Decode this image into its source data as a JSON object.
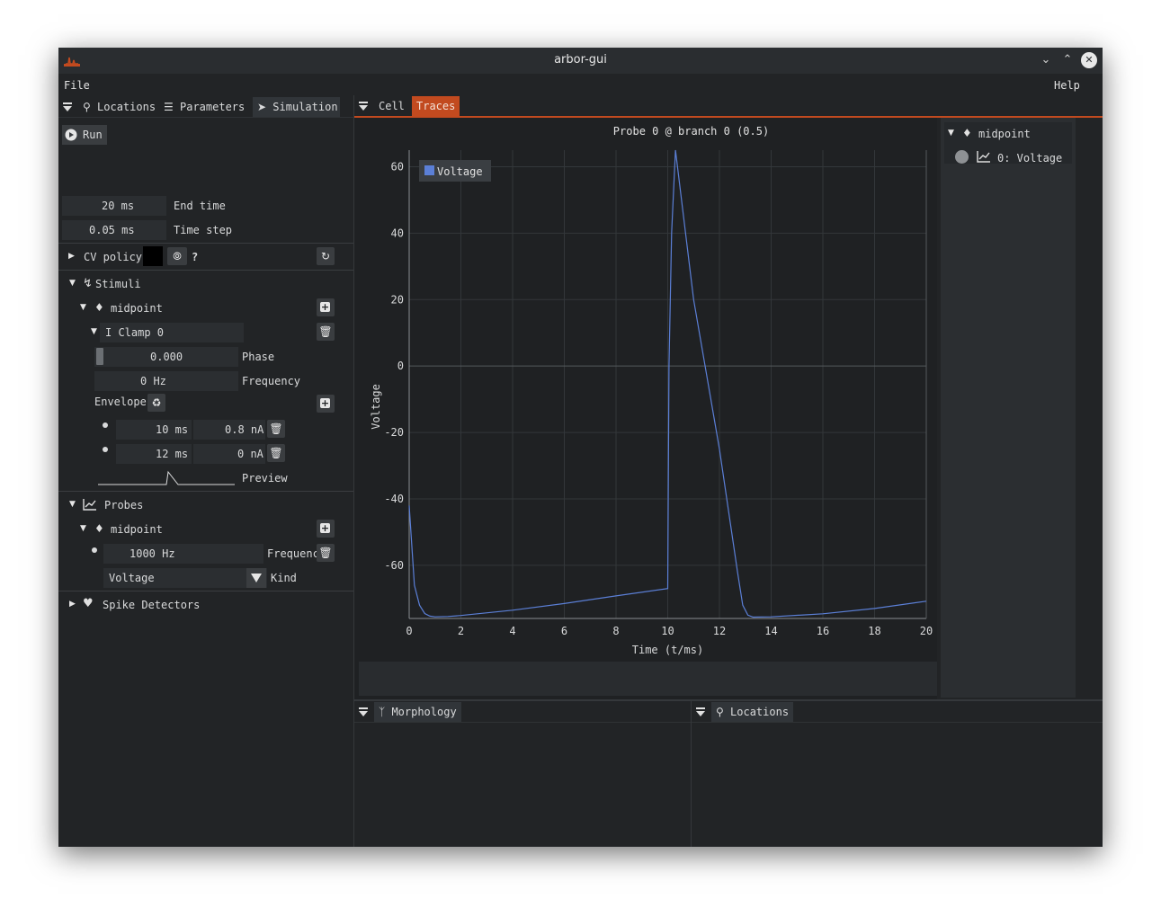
{
  "window": {
    "title": "arbor-gui"
  },
  "menu": {
    "file": "File",
    "help": "Help"
  },
  "left_tabs": {
    "locations": "Locations",
    "parameters": "Parameters",
    "simulation": "Simulation"
  },
  "simulation": {
    "run_label": "Run",
    "end_time_value": "20 ms",
    "end_time_label": "End time",
    "time_step_value": "0.05 ms",
    "time_step_label": "Time step",
    "cv_policy_label": "CV policy",
    "cv_help": "?",
    "stimuli_label": "Stimuli",
    "stim_location": "midpoint",
    "clamp_label": "I Clamp 0",
    "phase_value": "0.000",
    "phase_label": "Phase",
    "frequency_value": "0 Hz",
    "frequency_label": "Frequency",
    "envelope_label": "Envelope",
    "envelope": [
      {
        "time": "10 ms",
        "amplitude": "0.8 nA"
      },
      {
        "time": "12 ms",
        "amplitude": "0 nA"
      }
    ],
    "preview_label": "Preview",
    "probes_label": "Probes",
    "probe_location": "midpoint",
    "probe_freq_value": "1000 Hz",
    "probe_freq_label": "Frequenc",
    "probe_kind_value": "Voltage",
    "probe_kind_label": "Kind",
    "spike_label": "Spike Detectors"
  },
  "right_tabs": {
    "cell": "Cell",
    "traces": "Traces"
  },
  "trace_panel": {
    "location": "midpoint",
    "item": "0: Voltage"
  },
  "bottom_tabs": {
    "morphology": "Morphology",
    "locations": "Locations"
  },
  "colors": {
    "accent": "#c24a1f",
    "trace": "#5b7fd6",
    "background": "#222426"
  },
  "chart_data": {
    "type": "line",
    "title": "Probe 0 @ branch 0 (0.5)",
    "xlabel": "Time (t/ms)",
    "ylabel": "Voltage",
    "xlim": [
      0,
      20
    ],
    "ylim": [
      -76,
      65
    ],
    "xticks": [
      0,
      2,
      4,
      6,
      8,
      10,
      12,
      14,
      16,
      18,
      20
    ],
    "yticks": [
      60,
      40,
      20,
      0,
      -20,
      -40,
      -60
    ],
    "grid": true,
    "legend_position": "top-left",
    "series": [
      {
        "name": "Voltage",
        "x": [
          0,
          0.2,
          0.4,
          0.6,
          0.8,
          1.0,
          1.5,
          2,
          4,
          6,
          8,
          10.0,
          10.05,
          10.15,
          10.3,
          11.0,
          12.0,
          12.7,
          12.9,
          13.1,
          13.3,
          14,
          16,
          18,
          20
        ],
        "y": [
          -42,
          -66,
          -72,
          -74.5,
          -75.3,
          -75.5,
          -75.4,
          -75.1,
          -73.5,
          -71.5,
          -69.2,
          -67,
          0,
          40,
          65,
          20,
          -25,
          -62,
          -72,
          -75,
          -75.6,
          -75.5,
          -74.6,
          -73,
          -70.8
        ]
      }
    ]
  }
}
